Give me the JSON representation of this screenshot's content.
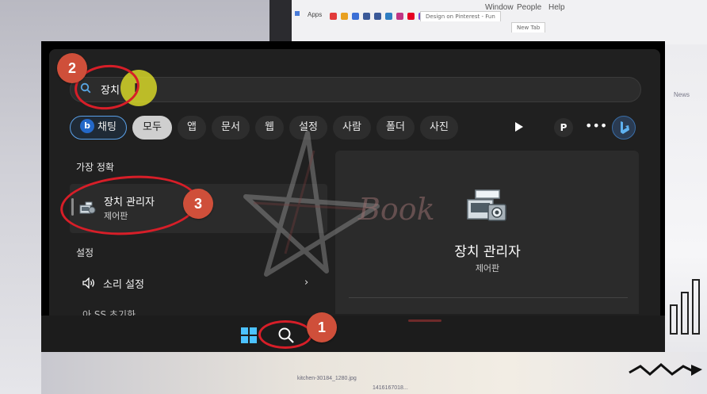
{
  "background": {
    "browser_menu": [
      "Window",
      "People",
      "Help"
    ],
    "browser_apps_label": "Apps",
    "browser_tabs": [
      "Design on Pinterest - Fun",
      "New Tab"
    ],
    "side_text": "News",
    "file_label": "kitchen-30184_1280.jpg",
    "file_label2": "1416167018..."
  },
  "search": {
    "query": "장치",
    "cursor_glyph": "I"
  },
  "filters": {
    "chat_label": "채팅",
    "chips": [
      "모두",
      "앱",
      "문서",
      "웹",
      "설정",
      "사람",
      "폴더",
      "사진"
    ],
    "active_index": 0,
    "profile_letter": "P",
    "more_glyph": "•••"
  },
  "results": {
    "best_match_heading": "가장 정확",
    "best_match_title": "장치 관리자",
    "best_match_subtitle": "제어판",
    "settings_heading": "설정",
    "settings_item": "소리 설정",
    "settings_item2_partial": "아 SS 초기화"
  },
  "preview": {
    "title": "장치 관리자",
    "subtitle": "제어판"
  },
  "watermark": {
    "text": "Book"
  },
  "annotations": [
    {
      "number": "1"
    },
    {
      "number": "2"
    },
    {
      "number": "3"
    }
  ],
  "colors": {
    "annotation_red": "#d71e28",
    "badge": "#cf4f3a",
    "panel_bg": "#202020",
    "bing_blue": "#2468c8"
  }
}
